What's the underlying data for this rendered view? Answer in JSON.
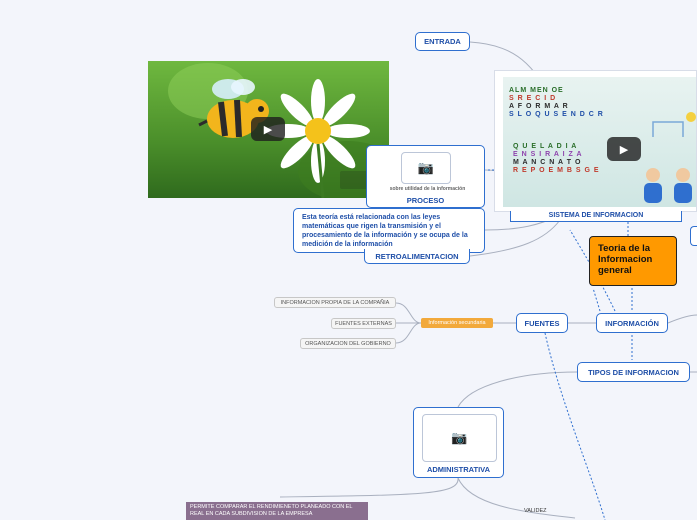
{
  "central_topic": "Teoria de la Informacion general",
  "nodes": {
    "entrada": "ENTRADA",
    "proceso": "PROCESO",
    "retroalimentacion": "RETROALIMENTACION",
    "sistema_informacion": "SISTEMA DE INFORMACION",
    "informacion": "INFORMACIÓN",
    "fuentes": "FUENTES",
    "tipos_informacion": "TIPOS DE INFORMACION",
    "administrativa": "ADMINISTRATIVA"
  },
  "description": "Esta teoría está relacionada con las leyes matemáticas que rigen la transmisión y el procesamiento de la información y se ocupa de la medición de la información",
  "video_caption_small": "sobre utilidad de la información",
  "secondary_label": "Información secundaria",
  "source_items": [
    "INFORMACION PROPIA DE LA COMPAÑIA",
    "FUENTES EXTERNAS",
    "ORGANIZACION DEL GOBIERNO"
  ],
  "note_text": "PERMITE COMPARAR EL RENDIMIENETO PLANEADO CON EL REAL EN CADA SUBDIVISION DE LA EMPRESA",
  "validez_label": "VALIDEZ",
  "video_text_lines": [
    "ALM MEN OE",
    "S R E C I D",
    "A F O R M A R",
    "S L O Q U S E N D C R",
    "Q U E L A D I A",
    "E N S I R A I Z A",
    "M A N C N A T O",
    "R E P O E M B S G E"
  ],
  "colors": {
    "node_border": "#2f6fcf",
    "node_text": "#1f4fa8",
    "central_fill": "#ff9900",
    "secondary_fill": "#f2a93b",
    "connector": "#9aa4b5"
  }
}
